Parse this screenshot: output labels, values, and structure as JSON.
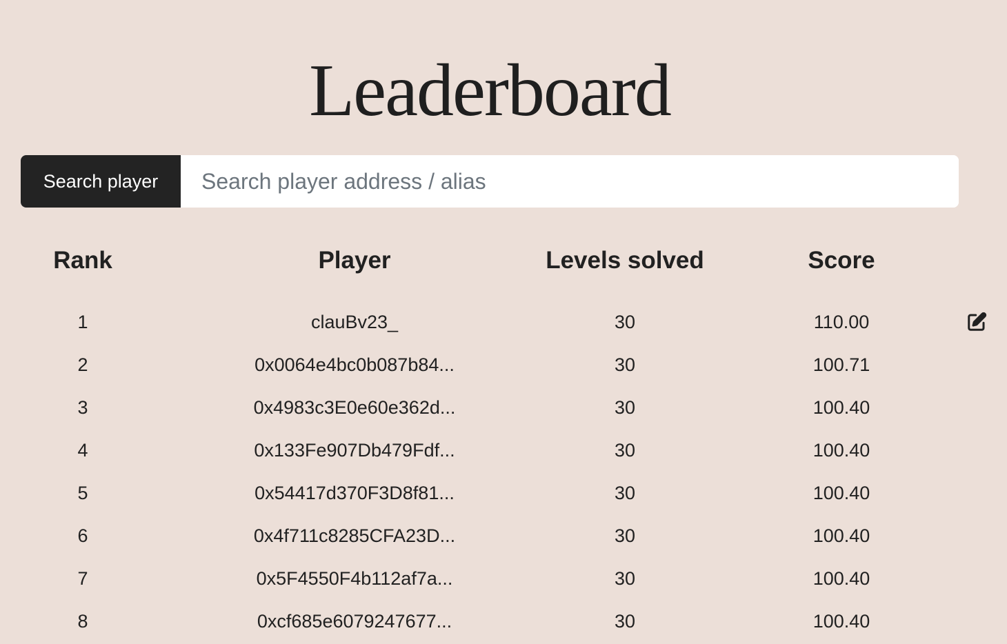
{
  "page": {
    "title": "Leaderboard"
  },
  "search": {
    "label": "Search player",
    "placeholder": "Search player address / alias",
    "value": ""
  },
  "table": {
    "headers": {
      "rank": "Rank",
      "player": "Player",
      "levels": "Levels solved",
      "score": "Score"
    },
    "rows": [
      {
        "rank": "1",
        "player": "clauBv23_",
        "levels": "30",
        "score": "110.00",
        "editable": true
      },
      {
        "rank": "2",
        "player": "0x0064e4bc0b087b84...",
        "levels": "30",
        "score": "100.71"
      },
      {
        "rank": "3",
        "player": "0x4983c3E0e60e362d...",
        "levels": "30",
        "score": "100.40"
      },
      {
        "rank": "4",
        "player": "0x133Fe907Db479Fdf...",
        "levels": "30",
        "score": "100.40"
      },
      {
        "rank": "5",
        "player": "0x54417d370F3D8f81...",
        "levels": "30",
        "score": "100.40"
      },
      {
        "rank": "6",
        "player": "0x4f711c8285CFA23D...",
        "levels": "30",
        "score": "100.40"
      },
      {
        "rank": "7",
        "player": "0x5F4550F4b112af7a...",
        "levels": "30",
        "score": "100.40"
      },
      {
        "rank": "8",
        "player": "0xcf685e6079247677...",
        "levels": "30",
        "score": "100.40"
      }
    ]
  },
  "icons": {
    "edit": "edit-icon"
  },
  "colors": {
    "background": "#ecdfd8",
    "search_label_bg": "#232323",
    "text": "#212121"
  }
}
